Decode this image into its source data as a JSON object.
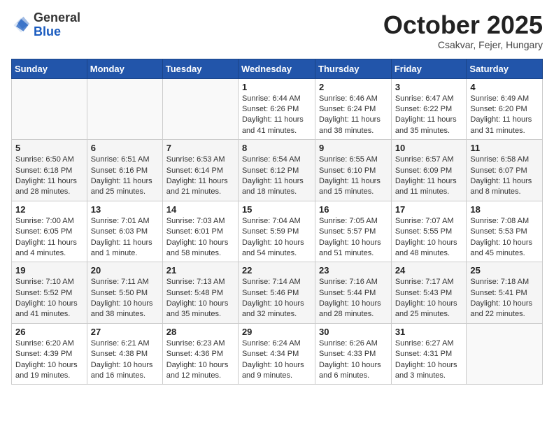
{
  "logo": {
    "general": "General",
    "blue": "Blue"
  },
  "header": {
    "month": "October 2025",
    "location": "Csakvar, Fejer, Hungary"
  },
  "weekdays": [
    "Sunday",
    "Monday",
    "Tuesday",
    "Wednesday",
    "Thursday",
    "Friday",
    "Saturday"
  ],
  "weeks": [
    [
      {
        "day": "",
        "info": ""
      },
      {
        "day": "",
        "info": ""
      },
      {
        "day": "",
        "info": ""
      },
      {
        "day": "1",
        "info": "Sunrise: 6:44 AM\nSunset: 6:26 PM\nDaylight: 11 hours and 41 minutes."
      },
      {
        "day": "2",
        "info": "Sunrise: 6:46 AM\nSunset: 6:24 PM\nDaylight: 11 hours and 38 minutes."
      },
      {
        "day": "3",
        "info": "Sunrise: 6:47 AM\nSunset: 6:22 PM\nDaylight: 11 hours and 35 minutes."
      },
      {
        "day": "4",
        "info": "Sunrise: 6:49 AM\nSunset: 6:20 PM\nDaylight: 11 hours and 31 minutes."
      }
    ],
    [
      {
        "day": "5",
        "info": "Sunrise: 6:50 AM\nSunset: 6:18 PM\nDaylight: 11 hours and 28 minutes."
      },
      {
        "day": "6",
        "info": "Sunrise: 6:51 AM\nSunset: 6:16 PM\nDaylight: 11 hours and 25 minutes."
      },
      {
        "day": "7",
        "info": "Sunrise: 6:53 AM\nSunset: 6:14 PM\nDaylight: 11 hours and 21 minutes."
      },
      {
        "day": "8",
        "info": "Sunrise: 6:54 AM\nSunset: 6:12 PM\nDaylight: 11 hours and 18 minutes."
      },
      {
        "day": "9",
        "info": "Sunrise: 6:55 AM\nSunset: 6:10 PM\nDaylight: 11 hours and 15 minutes."
      },
      {
        "day": "10",
        "info": "Sunrise: 6:57 AM\nSunset: 6:09 PM\nDaylight: 11 hours and 11 minutes."
      },
      {
        "day": "11",
        "info": "Sunrise: 6:58 AM\nSunset: 6:07 PM\nDaylight: 11 hours and 8 minutes."
      }
    ],
    [
      {
        "day": "12",
        "info": "Sunrise: 7:00 AM\nSunset: 6:05 PM\nDaylight: 11 hours and 4 minutes."
      },
      {
        "day": "13",
        "info": "Sunrise: 7:01 AM\nSunset: 6:03 PM\nDaylight: 11 hours and 1 minute."
      },
      {
        "day": "14",
        "info": "Sunrise: 7:03 AM\nSunset: 6:01 PM\nDaylight: 10 hours and 58 minutes."
      },
      {
        "day": "15",
        "info": "Sunrise: 7:04 AM\nSunset: 5:59 PM\nDaylight: 10 hours and 54 minutes."
      },
      {
        "day": "16",
        "info": "Sunrise: 7:05 AM\nSunset: 5:57 PM\nDaylight: 10 hours and 51 minutes."
      },
      {
        "day": "17",
        "info": "Sunrise: 7:07 AM\nSunset: 5:55 PM\nDaylight: 10 hours and 48 minutes."
      },
      {
        "day": "18",
        "info": "Sunrise: 7:08 AM\nSunset: 5:53 PM\nDaylight: 10 hours and 45 minutes."
      }
    ],
    [
      {
        "day": "19",
        "info": "Sunrise: 7:10 AM\nSunset: 5:52 PM\nDaylight: 10 hours and 41 minutes."
      },
      {
        "day": "20",
        "info": "Sunrise: 7:11 AM\nSunset: 5:50 PM\nDaylight: 10 hours and 38 minutes."
      },
      {
        "day": "21",
        "info": "Sunrise: 7:13 AM\nSunset: 5:48 PM\nDaylight: 10 hours and 35 minutes."
      },
      {
        "day": "22",
        "info": "Sunrise: 7:14 AM\nSunset: 5:46 PM\nDaylight: 10 hours and 32 minutes."
      },
      {
        "day": "23",
        "info": "Sunrise: 7:16 AM\nSunset: 5:44 PM\nDaylight: 10 hours and 28 minutes."
      },
      {
        "day": "24",
        "info": "Sunrise: 7:17 AM\nSunset: 5:43 PM\nDaylight: 10 hours and 25 minutes."
      },
      {
        "day": "25",
        "info": "Sunrise: 7:18 AM\nSunset: 5:41 PM\nDaylight: 10 hours and 22 minutes."
      }
    ],
    [
      {
        "day": "26",
        "info": "Sunrise: 6:20 AM\nSunset: 4:39 PM\nDaylight: 10 hours and 19 minutes."
      },
      {
        "day": "27",
        "info": "Sunrise: 6:21 AM\nSunset: 4:38 PM\nDaylight: 10 hours and 16 minutes."
      },
      {
        "day": "28",
        "info": "Sunrise: 6:23 AM\nSunset: 4:36 PM\nDaylight: 10 hours and 12 minutes."
      },
      {
        "day": "29",
        "info": "Sunrise: 6:24 AM\nSunset: 4:34 PM\nDaylight: 10 hours and 9 minutes."
      },
      {
        "day": "30",
        "info": "Sunrise: 6:26 AM\nSunset: 4:33 PM\nDaylight: 10 hours and 6 minutes."
      },
      {
        "day": "31",
        "info": "Sunrise: 6:27 AM\nSunset: 4:31 PM\nDaylight: 10 hours and 3 minutes."
      },
      {
        "day": "",
        "info": ""
      }
    ]
  ]
}
